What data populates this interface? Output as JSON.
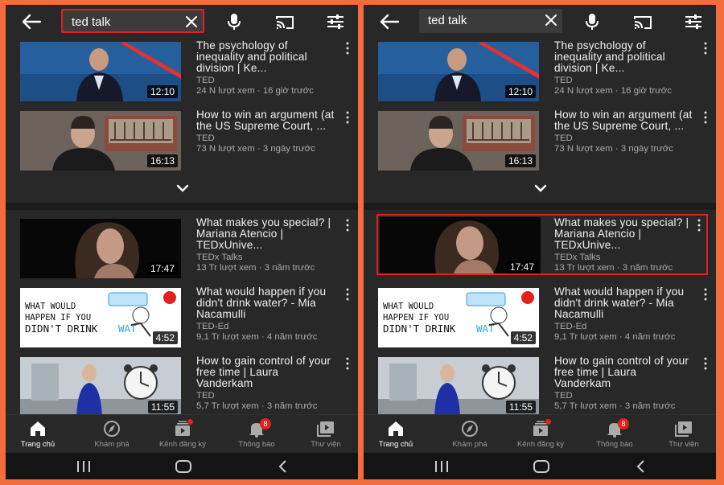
{
  "colors": {
    "frame": "#f26d3b",
    "highlight": "#e3201b",
    "background": "#282828"
  },
  "search": {
    "query": "ted talk"
  },
  "icons": {
    "back": "arrow-left-icon",
    "clear": "close-icon",
    "mic": "microphone-icon",
    "cast": "cast-icon",
    "filter": "filter-sliders-icon",
    "more": "more-vertical-icon",
    "expand": "chevron-down-icon"
  },
  "top_videos": [
    {
      "title": "The psychology of inequality and political division | Ke...",
      "channel": "TED",
      "meta": "24 N lượt xem · 16 giờ trước",
      "duration": "12:10"
    },
    {
      "title": "How to win an argument (at the US Supreme Court, ...",
      "channel": "TED",
      "meta": "73 N lượt xem · 3 ngày trước",
      "duration": "16:13"
    }
  ],
  "bottom_videos": [
    {
      "title": "What makes you special? | Mariana Atencio | TEDxUnive...",
      "channel": "TEDx Talks",
      "meta": "13 Tr lượt xem · 3 năm trước",
      "duration": "17:47"
    },
    {
      "title": "What would happen if you didn't drink water? - Mia Nacamulli",
      "channel": "TED-Ed",
      "meta": "9,1 Tr lượt xem · 4 năm trước",
      "duration": "4:52",
      "thumb_text": [
        "WHAT WOULD",
        "HAPPEN IF YOU",
        "DIDN'T DRINK",
        "WAT"
      ]
    },
    {
      "title": "How to gain control of your free time | Laura Vanderkam",
      "channel": "TED",
      "meta": "5,7 Tr lượt xem · 3 năm trước",
      "duration": "11:55"
    }
  ],
  "nav": [
    {
      "label": "Trang chủ",
      "icon": "home-icon"
    },
    {
      "label": "Khám phá",
      "icon": "compass-icon"
    },
    {
      "label": "Kênh đăng ký",
      "icon": "subscriptions-icon"
    },
    {
      "label": "Thông báo",
      "icon": "bell-icon",
      "badge": "8"
    },
    {
      "label": "Thư viện",
      "icon": "library-icon"
    }
  ],
  "system_nav": [
    "recent-apps-icon",
    "home-button-icon",
    "back-button-icon"
  ]
}
